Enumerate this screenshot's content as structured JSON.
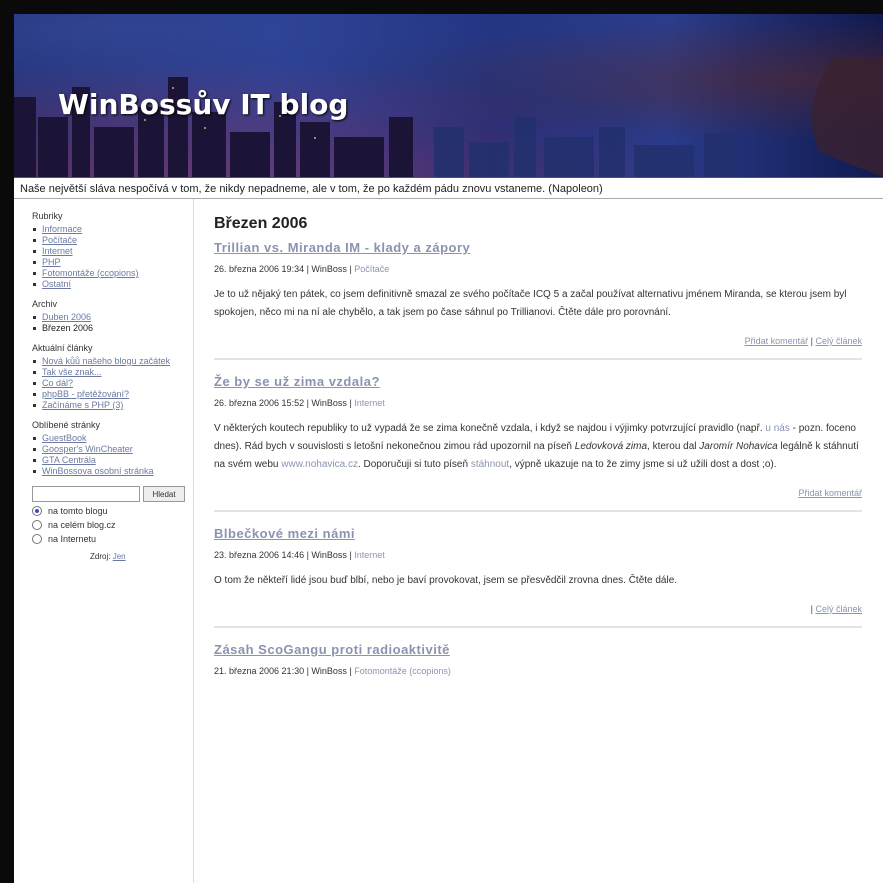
{
  "header": {
    "blog_title": "WinBossův IT blog",
    "tagline": "Naše největší sláva nespočívá v tom, že nikdy nepadneme, ale v tom, že po každém pádu znovu vstaneme. (Napoleon)"
  },
  "sidebar": {
    "categories_heading": "Rubriky",
    "categories": [
      "Informace",
      "Počítače",
      "Internet",
      "PHP",
      "Fotomontáže (ccopions)",
      "Ostatní"
    ],
    "archive_heading": "Archiv",
    "archive": [
      "Duben 2006",
      "Březen 2006"
    ],
    "recent_heading": "Aktuální články",
    "recent": [
      "Nová kůů našeho blogu začátek",
      "Tak vše znak...",
      "Co dál?",
      "phpBB - přetěžování?",
      "Začínáme s PHP (3)"
    ],
    "favorites_heading": "Oblíbené stránky",
    "favorites": [
      "GuestBook",
      "Goosper's WinCheater",
      "GTA Centrála",
      "WinBossova osobní stránka"
    ],
    "search_button": "Hledat",
    "search_options": [
      "na tomto blogu",
      "na celém blog.cz",
      "na Internetu"
    ],
    "credit_prefix": "Zdroj:",
    "credit_link": "Jen"
  },
  "main": {
    "month": "Březen 2006",
    "posts": [
      {
        "title": "Trillian vs. Miranda IM - klady a zápory",
        "date": "26. března 2006 19:34",
        "author": "WinBoss",
        "category": "Počítače",
        "body": "Je to už nějaký ten pátek, co jsem definitivně smazal ze svého počítače ICQ 5 a začal používat alternativu jménem Miranda, se kterou jsem byl spokojen, něco mi na ní ale chybělo, a tak jsem po čase sáhnul po Trillianovi. Čtěte dále pro porovnání.",
        "comment_link": "Přidat komentář",
        "full_link": "Celý článek"
      },
      {
        "title": "Že by se už zima vzdala?",
        "date": "26. března 2006 15:52",
        "author": "WinBoss",
        "category": "Internet",
        "body_part1": "V některých koutech republiky to už vypadá že se zima konečně vzdala, i když se najdou i výjimky potvrzující pravidlo (např. ",
        "body_link1": "u nás",
        "body_part2": " - pozn. foceno dnes). Rád bych v souvislosti s letošní nekonečnou zimou rád upozornil na píseň ",
        "body_em1": "Ledovková zima",
        "body_part3": ", kterou dal ",
        "body_em2": "Jaromír Nohavica",
        "body_part4": " legálně k stáhnutí na svém webu ",
        "body_link2": "www.nohavica.cz",
        "body_part5": ". Doporučuji si tuto píseň ",
        "body_link3": "stáhnout",
        "body_part6": ", výpně ukazuje na to že zimy jsme si už užili dost a dost ;o).",
        "comment_link": "Přidat komentář"
      },
      {
        "title": "Blbečkové mezi námi",
        "date": "23. března 2006 14:46",
        "author": "WinBoss",
        "category": "Internet",
        "body": "O tom že někteří lidé jsou buď blbí, nebo je baví provokovat, jsem se přesvědčil zrovna dnes. Čtěte dále.",
        "full_link": "Celý článek"
      },
      {
        "title": "Zásah ScoGangu proti radioaktivitě",
        "date": "21. března 2006 21:30",
        "author": "WinBoss",
        "category": "Fotomontáže (ccopions)"
      }
    ]
  },
  "colors": {
    "link": "#8a94b0",
    "header_bg": "#1a2a6e",
    "page_frame": "#0a0a0a"
  }
}
